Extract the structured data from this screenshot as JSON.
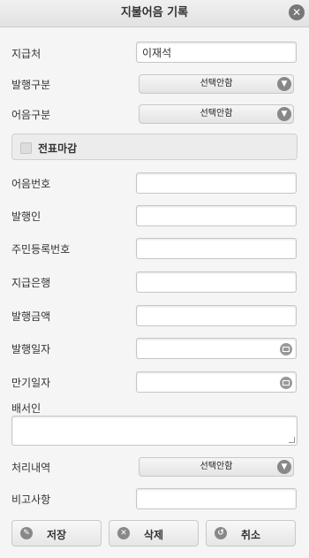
{
  "dialog": {
    "title": "지불어음 기록"
  },
  "fields": {
    "payee": {
      "label": "지급처",
      "value": "이재석"
    },
    "issue_type": {
      "label": "발행구분",
      "selected": "선택안함"
    },
    "note_type": {
      "label": "어음구분",
      "selected": "선택안함"
    },
    "slip_close": {
      "label": "전표마감"
    },
    "note_number": {
      "label": "어음번호",
      "value": ""
    },
    "issuer": {
      "label": "발행인",
      "value": ""
    },
    "resident_number": {
      "label": "주민등록번호",
      "value": ""
    },
    "paying_bank": {
      "label": "지급은행",
      "value": ""
    },
    "issue_amount": {
      "label": "발행금액",
      "value": ""
    },
    "issue_date": {
      "label": "발행일자",
      "value": ""
    },
    "maturity_date": {
      "label": "만기일자",
      "value": ""
    },
    "endorser": {
      "label": "배서인",
      "value": ""
    },
    "processing": {
      "label": "처리내역",
      "selected": "선택안함"
    },
    "remarks": {
      "label": "비고사항",
      "value": ""
    }
  },
  "buttons": {
    "save": "저장",
    "delete": "삭제",
    "cancel": "취소"
  },
  "icons": {
    "close": "close-icon",
    "select_arrow": "chevron-down-icon",
    "calendar": "calendar-icon",
    "save": "edit-icon",
    "delete": "delete-icon",
    "cancel": "undo-icon"
  }
}
